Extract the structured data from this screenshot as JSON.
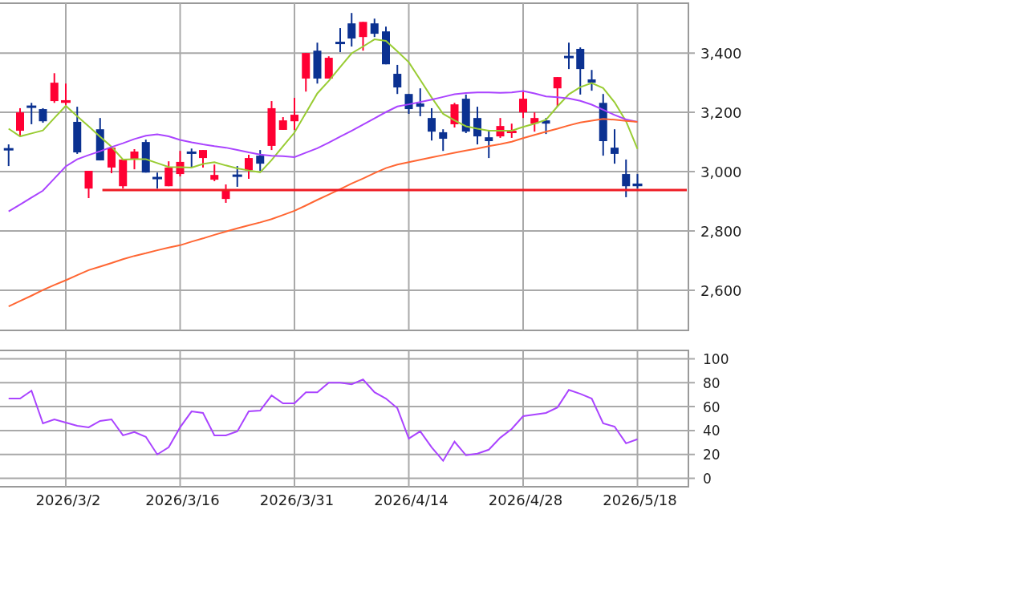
{
  "price_chart": {
    "chart_data": {
      "type": "candlestick",
      "categories": [
        null,
        null,
        null,
        null,
        null,
        null,
        null,
        null,
        null,
        null,
        null,
        null,
        null,
        null,
        null,
        null,
        null,
        null,
        null,
        null,
        null,
        null,
        null,
        null,
        null,
        null,
        null,
        null,
        null,
        null,
        null,
        null,
        null,
        null,
        null,
        null,
        null,
        null,
        null,
        null,
        null,
        null,
        null,
        null,
        null,
        null,
        null,
        null,
        null,
        null,
        null,
        null,
        null,
        null,
        null,
        null
      ],
      "grid": true,
      "ylim": [
        2465,
        3568
      ],
      "yticks": [
        {
          "value": 3400,
          "label": "3,400"
        },
        {
          "value": 3200,
          "label": "3,200"
        },
        {
          "value": 3000,
          "label": "3,000"
        },
        {
          "value": 2800,
          "label": "2,800"
        },
        {
          "value": 2600,
          "label": "2,600"
        }
      ],
      "ohlc": [
        [
          3078,
          3092,
          3019,
          3073
        ],
        [
          3138,
          3214,
          3119,
          3200
        ],
        [
          3222,
          3232,
          3160,
          3216
        ],
        [
          3211,
          3214,
          3165,
          3170
        ],
        [
          3238,
          3332,
          3232,
          3300
        ],
        [
          3232,
          3297,
          3219,
          3241
        ],
        [
          3168,
          3219,
          3060,
          3065
        ],
        [
          2943,
          3003,
          2911,
          3003
        ],
        [
          3143,
          3181,
          3038,
          3038
        ],
        [
          3014,
          3081,
          2995,
          3081
        ],
        [
          2951,
          3041,
          2943,
          3041
        ],
        [
          3041,
          3076,
          3008,
          3068
        ],
        [
          3100,
          3108,
          2997,
          2997
        ],
        [
          2981,
          2997,
          2943,
          2976
        ],
        [
          2951,
          3035,
          2951,
          3014
        ],
        [
          2992,
          3070,
          2984,
          3033
        ],
        [
          3068,
          3078,
          3016,
          3060
        ],
        [
          3046,
          3073,
          3014,
          3073
        ],
        [
          2973,
          3024,
          2968,
          2989
        ],
        [
          2908,
          2957,
          2895,
          2938
        ],
        [
          2989,
          3019,
          2949,
          2984
        ],
        [
          3005,
          3057,
          2976,
          3046
        ],
        [
          3054,
          3073,
          3003,
          3027
        ],
        [
          3087,
          3238,
          3073,
          3214
        ],
        [
          3141,
          3184,
          3141,
          3173
        ],
        [
          3170,
          3249,
          3141,
          3192
        ],
        [
          3314,
          3400,
          3270,
          3400
        ],
        [
          3408,
          3435,
          3297,
          3314
        ],
        [
          3314,
          3389,
          3314,
          3384
        ],
        [
          3438,
          3484,
          3403,
          3430
        ],
        [
          3500,
          3535,
          3422,
          3449
        ],
        [
          3454,
          3505,
          3408,
          3505
        ],
        [
          3500,
          3516,
          3454,
          3465
        ],
        [
          3473,
          3489,
          3362,
          3362
        ],
        [
          3330,
          3360,
          3262,
          3284
        ],
        [
          3262,
          3262,
          3195,
          3211
        ],
        [
          3230,
          3281,
          3187,
          3219
        ],
        [
          3181,
          3214,
          3105,
          3135
        ],
        [
          3133,
          3143,
          3070,
          3111
        ],
        [
          3160,
          3232,
          3149,
          3227
        ],
        [
          3246,
          3260,
          3130,
          3135
        ],
        [
          3181,
          3219,
          3092,
          3119
        ],
        [
          3116,
          3141,
          3046,
          3103
        ],
        [
          3119,
          3181,
          3114,
          3154
        ],
        [
          3130,
          3162,
          3114,
          3138
        ],
        [
          3200,
          3273,
          3181,
          3246
        ],
        [
          3162,
          3200,
          3135,
          3181
        ],
        [
          3173,
          3181,
          3127,
          3162
        ],
        [
          3281,
          3319,
          3219,
          3319
        ],
        [
          3389,
          3435,
          3346,
          3384
        ],
        [
          3414,
          3419,
          3260,
          3346
        ],
        [
          3311,
          3343,
          3273,
          3300
        ],
        [
          3232,
          3262,
          3054,
          3103
        ],
        [
          3081,
          3143,
          3027,
          3060
        ],
        [
          2992,
          3041,
          2914,
          2951
        ],
        [
          2960,
          2992,
          2943,
          2951
        ]
      ],
      "series": [
        {
          "type": "line",
          "color": "#99cc33",
          "values": [
            3145,
            3119,
            3129,
            3139,
            3181,
            3222,
            3187,
            3153,
            3118,
            3084,
            3041,
            3042,
            3042,
            3029,
            3016,
            3015,
            3014,
            3026,
            3032,
            3021,
            3011,
            3004,
            2998,
            3039,
            3086,
            3132,
            3198,
            3264,
            3306,
            3353,
            3399,
            3422,
            3446,
            3441,
            3406,
            3369,
            3310,
            3250,
            3195,
            3173,
            3153,
            3145,
            3138,
            3138,
            3138,
            3151,
            3162,
            3175,
            3220,
            3261,
            3285,
            3299,
            3282,
            3234,
            3170,
            3077
          ]
        },
        {
          "type": "line",
          "color": "#aa44ff",
          "values": [
            2866,
            2889,
            2913,
            2936,
            2977,
            3018,
            3042,
            3056,
            3069,
            3083,
            3096,
            3110,
            3121,
            3126,
            3119,
            3107,
            3099,
            3092,
            3086,
            3081,
            3073,
            3065,
            3058,
            3054,
            3052,
            3049,
            3064,
            3079,
            3098,
            3118,
            3138,
            3159,
            3180,
            3201,
            3220,
            3227,
            3235,
            3243,
            3252,
            3261,
            3265,
            3267,
            3267,
            3266,
            3267,
            3272,
            3264,
            3254,
            3251,
            3247,
            3239,
            3226,
            3209,
            3191,
            3176,
            3168
          ]
        },
        {
          "type": "line",
          "color": "#ff6633",
          "values": [
            2546,
            2564,
            2582,
            2601,
            2618,
            2634,
            2651,
            2668,
            2680,
            2692,
            2705,
            2716,
            2725,
            2735,
            2744,
            2752,
            2764,
            2775,
            2787,
            2798,
            2809,
            2819,
            2829,
            2840,
            2854,
            2868,
            2886,
            2905,
            2923,
            2941,
            2960,
            2977,
            2995,
            3012,
            3024,
            3032,
            3040,
            3048,
            3056,
            3064,
            3071,
            3078,
            3086,
            3093,
            3101,
            3113,
            3124,
            3135,
            3145,
            3156,
            3166,
            3172,
            3178,
            3175,
            3171,
            3168
          ]
        }
      ],
      "ref_lines": [
        {
          "axis": "y",
          "value": 2938,
          "color": "#ee1c24"
        }
      ]
    }
  },
  "indicator_chart": {
    "chart_data": {
      "type": "line",
      "categories": [
        null,
        null,
        null,
        null,
        null,
        "2026/3/2",
        null,
        null,
        null,
        null,
        null,
        null,
        null,
        null,
        null,
        "2026/3/16",
        null,
        null,
        null,
        null,
        null,
        null,
        null,
        null,
        null,
        "2026/3/31",
        null,
        null,
        null,
        null,
        null,
        null,
        null,
        null,
        null,
        "2026/4/14",
        null,
        null,
        null,
        null,
        null,
        null,
        null,
        null,
        null,
        "2026/4/28",
        null,
        null,
        null,
        null,
        null,
        null,
        null,
        null,
        null,
        "2026/5/18"
      ],
      "grid": true,
      "ylim": [
        -7,
        107
      ],
      "yticks": [
        0,
        20,
        40,
        60,
        80,
        100
      ],
      "series": [
        {
          "color": "#aa44ff",
          "values": [
            66.7,
            66.7,
            73.3,
            46,
            49.3,
            46.7,
            44,
            42.7,
            48,
            49.3,
            36,
            38.7,
            34.7,
            20,
            26,
            42.7,
            56,
            54.7,
            36,
            36,
            39.3,
            56,
            56.7,
            69.3,
            62.7,
            62.7,
            72,
            72,
            80,
            80,
            78.7,
            82.7,
            72,
            66.7,
            58.7,
            33.3,
            39.3,
            26,
            14.7,
            30.7,
            19.3,
            20.7,
            24,
            34,
            41.3,
            52,
            53.3,
            54.7,
            59.3,
            74,
            70.7,
            66.7,
            46,
            43.3,
            29.3,
            32.7
          ]
        }
      ]
    }
  }
}
